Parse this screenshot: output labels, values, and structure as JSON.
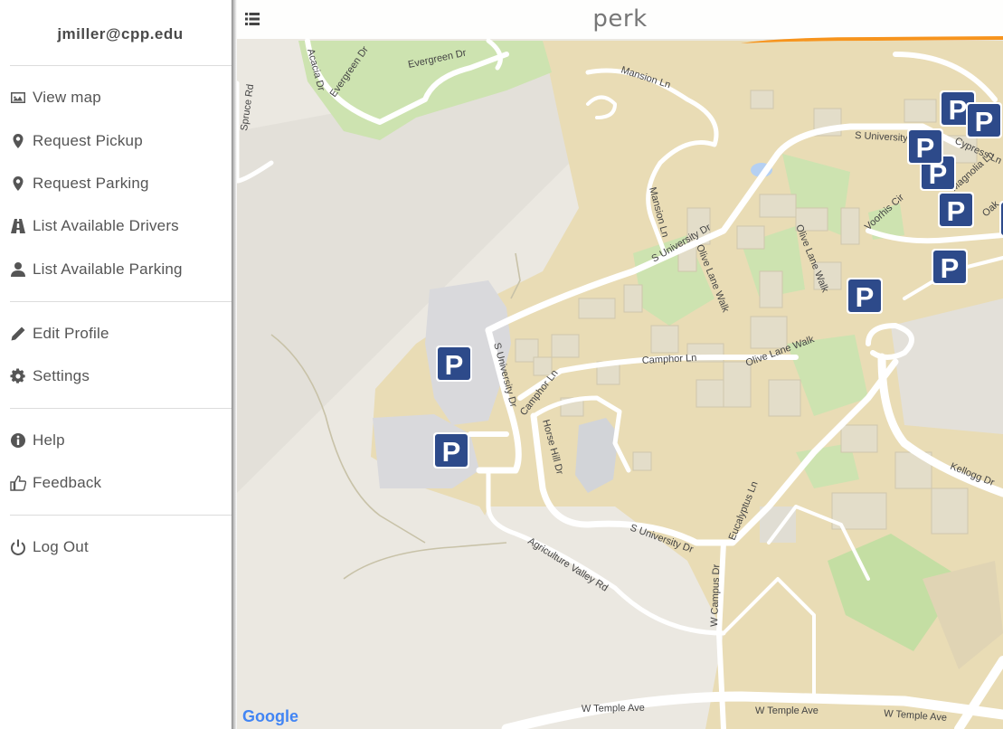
{
  "app": {
    "title": "perk",
    "menu_icon": "list-icon"
  },
  "user": {
    "email": "jmiller@cpp.edu"
  },
  "menu": {
    "view_map": "View map",
    "request_pickup": "Request Pickup",
    "request_parking": "Request Parking",
    "list_drivers": "List Available Drivers",
    "list_parking": "List Available Parking",
    "edit_profile": "Edit Profile",
    "settings": "Settings",
    "help": "Help",
    "feedback": "Feedback",
    "logout": "Log Out"
  },
  "icons": {
    "view_map": "image-icon",
    "request_pickup": "map-marker-icon",
    "request_parking": "map-marker-icon",
    "list_drivers": "road-icon",
    "list_parking": "user-icon",
    "edit_profile": "pencil-icon",
    "settings": "gear-icon",
    "help": "info-icon",
    "feedback": "thumbs-up-icon",
    "logout": "power-icon"
  },
  "map": {
    "attribution": "Google",
    "parking_marker_label": "P",
    "road_labels": {
      "spruce": "Spruce Rd",
      "acacia": "Acacia Dr",
      "evergreen1": "Evergreen Dr",
      "evergreen2": "Evergreen Dr",
      "mansion1": "Mansion Ln",
      "mansion2": "Mansion Ln",
      "s_univ1": "S University Dr",
      "s_univ2": "S University Dr",
      "s_univ3": "S University Dr",
      "s_univ4": "S University Dr",
      "olive1": "Olive Lane Walk",
      "olive2": "Olive Lane Walk",
      "olive3": "Olive Lane Walk",
      "camphor1": "Camphor Ln",
      "camphor2": "Camphor Ln",
      "horse_hill": "Horse Hill Dr",
      "voorhis": "Voorhis Cir",
      "cypress": "Cypress Ln",
      "magnolia": "Magnolia Ln",
      "oak": "Oak",
      "kellogg": "Kellogg Dr",
      "eucalyptus": "Eucalyptus Ln",
      "ag_valley": "Agriculture Valley Rd",
      "w_campus": "W Campus Dr",
      "temple1": "W Temple Ave",
      "temple2": "W Temple Ave",
      "temple3": "W Temple Ave"
    },
    "colors": {
      "campus": "#e9dcb5",
      "ground": "#ebe8e1",
      "green": "#cde3b0",
      "water": "#b5d0f2",
      "parking_lot": "#d9d9dc",
      "road": "#ffffff",
      "marker": "#2d4a8a",
      "accent": "#f7941d"
    }
  }
}
